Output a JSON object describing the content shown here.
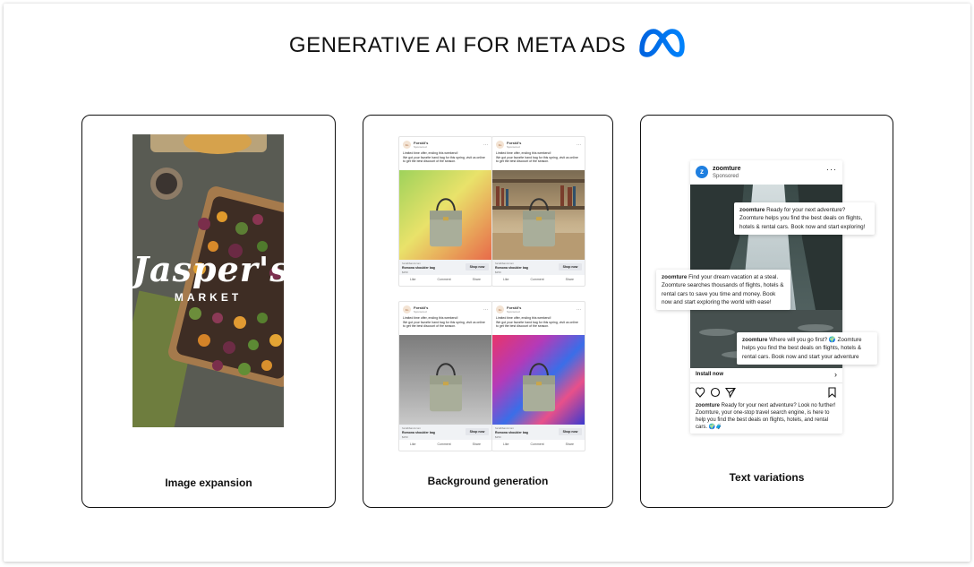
{
  "header": {
    "title": "GENERATIVE AI FOR META ADS",
    "logo_icon": "meta-infinity-logo",
    "brand_color": "#0866ff"
  },
  "cards": [
    {
      "label": "Image expansion",
      "image": {
        "brand_title": "Jasper's",
        "brand_subtitle": "MARKET"
      }
    },
    {
      "label": "Background generation",
      "ads": [
        {
          "page_name": "Forskli's",
          "sponsored": "Sponsored",
          "copy_line1": "Limited time offer, ending this weekend!",
          "copy_line2": "We got your favorite hand bag for this spring, visit us online to get the best discount of the season.",
          "url": "forskliband.com",
          "product": "Romona shoulder bag",
          "price": "$250",
          "cta": "Shop now",
          "actions": [
            "Like",
            "Comment",
            "Share"
          ],
          "background": "yellow-green gradient"
        },
        {
          "page_name": "Forskli's",
          "sponsored": "Sponsored",
          "copy_line1": "Limited time offer, ending this weekend!",
          "copy_line2": "We got your favorite hand bag for this spring, visit us online to get the best discount of the season.",
          "url": "forskliband.com",
          "product": "Romona shoulder bag",
          "price": "$250",
          "cta": "Shop now",
          "actions": [
            "Like",
            "Comment",
            "Share"
          ],
          "background": "bookshelf"
        },
        {
          "page_name": "Forskli's",
          "sponsored": "Sponsored",
          "copy_line1": "Limited time offer, ending this weekend!",
          "copy_line2": "We got your favorite hand bag for this spring, visit us online to get the best discount of the season.",
          "url": "forskliband.com",
          "product": "Romona shoulder bag",
          "price": "$250",
          "cta": "Shop now",
          "actions": [
            "Like",
            "Comment",
            "Share"
          ],
          "background": "grey studio"
        },
        {
          "page_name": "Forskli's",
          "sponsored": "Sponsored",
          "copy_line1": "Limited time offer, ending this weekend!",
          "copy_line2": "We got your favorite hand bag for this spring, visit us online to get the best discount of the season.",
          "url": "forskliband.com",
          "product": "Romona shoulder bag",
          "price": "$250",
          "cta": "Shop now",
          "actions": [
            "Like",
            "Comment",
            "Share"
          ],
          "background": "pink-blue paint"
        }
      ]
    },
    {
      "label": "Text variations",
      "post": {
        "account": "zoomture",
        "sponsored": "Sponsored",
        "install": "Install now",
        "caption_account": "zoomture",
        "caption": "Ready for your next adventure? Look no further! Zoomture, your one-stop travel search engine, is here to help you find the best deals on flights, hotels, and rental cars. 🌍🧳"
      },
      "variations": [
        {
          "account": "zoomture",
          "text": "Ready for your next adventure? Zoomture helps you find the best deals on flights, hotels & rental cars. Book now and start exploring!"
        },
        {
          "account": "zoomture",
          "text": "Find your dream vacation at a steal. Zoomture searches thousands of flights, hotels & rental cars to save you time and money. Book now and start exploring the world with ease!"
        },
        {
          "account": "zoomture",
          "text": "Where will you go first? 🌍 Zoomture helps you find the best deals on flights, hotels & rental cars. Book now and start your adventure"
        }
      ]
    }
  ]
}
